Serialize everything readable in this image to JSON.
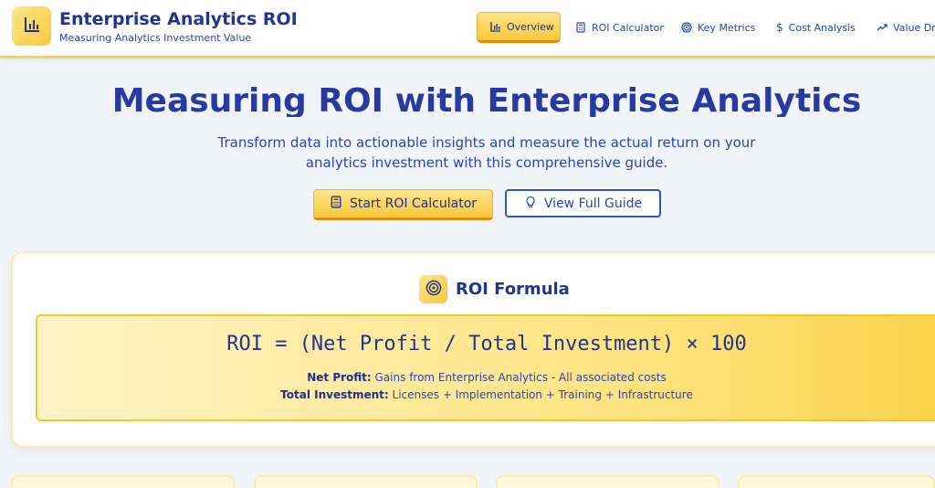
{
  "header": {
    "title": "Enterprise Analytics ROI",
    "subtitle": "Measuring Analytics Investment Value",
    "logo_icon": "bar-chart-icon",
    "nav": [
      {
        "label": "Overview",
        "icon": "bar-chart-icon",
        "active": true
      },
      {
        "label": "ROI Calculator",
        "icon": "calculator-icon",
        "active": false
      },
      {
        "label": "Key Metrics",
        "icon": "target-icon",
        "active": false
      },
      {
        "label": "Cost Analysis",
        "icon": "dollar-icon",
        "active": false
      },
      {
        "label": "Value Driv",
        "icon": "trending-up-icon",
        "active": false
      }
    ]
  },
  "hero": {
    "title": "Measuring ROI with Enterprise Analytics",
    "subtitle": "Transform data into actionable insights and measure the actual return on your analytics investment with this comprehensive guide.",
    "primary_button": "Start ROI Calculator",
    "secondary_button": "View Full Guide"
  },
  "formula_card": {
    "title": "ROI Formula",
    "formula": "ROI = (Net Profit / Total Investment) × 100",
    "net_profit_term": "Net Profit:",
    "net_profit_def": "Gains from Enterprise Analytics - All associated costs",
    "total_investment_term": "Total Investment:",
    "total_investment_def": "Licenses + Implementation + Training + Infrastructure"
  },
  "colors": {
    "accent_yellow": "#f8c83a",
    "accent_orange": "#e68a0c",
    "primary_blue": "#283a9f",
    "link_blue": "#2f56c8"
  }
}
